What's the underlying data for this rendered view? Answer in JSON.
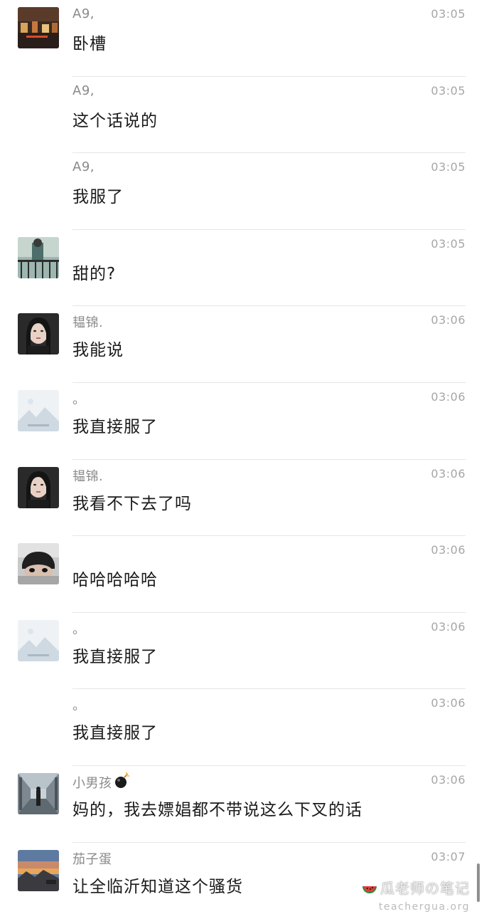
{
  "messages": [
    {
      "sender": "A9,",
      "time": "03:05",
      "text": "卧槽",
      "avatar": "avatar-street-night"
    },
    {
      "sender": "A9,",
      "time": "03:05",
      "text": "这个话说的",
      "avatar": ""
    },
    {
      "sender": "A9,",
      "time": "03:05",
      "text": "我服了",
      "avatar": ""
    },
    {
      "sender": "",
      "time": "03:05",
      "text": "甜的?",
      "avatar": "avatar-man-balcony"
    },
    {
      "sender": "韫锦.",
      "time": "03:06",
      "text": "我能说",
      "avatar": "avatar-woman-portrait"
    },
    {
      "sender": "。",
      "time": "03:06",
      "text": "我直接服了",
      "avatar": "avatar-placeholder-image"
    },
    {
      "sender": "韫锦.",
      "time": "03:06",
      "text": "我看不下去了吗",
      "avatar": "avatar-woman-portrait"
    },
    {
      "sender": "",
      "time": "03:06",
      "text": "哈哈哈哈哈",
      "avatar": "avatar-boy-peek"
    },
    {
      "sender": "。",
      "time": "03:06",
      "text": "我直接服了",
      "avatar": "avatar-placeholder-image"
    },
    {
      "sender": "。",
      "time": "03:06",
      "text": "我直接服了",
      "avatar": ""
    },
    {
      "sender": "小男孩",
      "time": "03:06",
      "text": "妈的，我去嫖娼都不带说这么下叉的话",
      "avatar": "avatar-corridor-man",
      "sender_emoji": "bomb-icon"
    },
    {
      "sender": "茄子蛋",
      "time": "03:07",
      "text": "让全临沂知道这个骚货",
      "avatar": "avatar-sunset-landscape"
    }
  ],
  "watermark": {
    "title": "瓜老师の笔记",
    "url": "teachergua.org",
    "icon": "watermelon-icon"
  }
}
